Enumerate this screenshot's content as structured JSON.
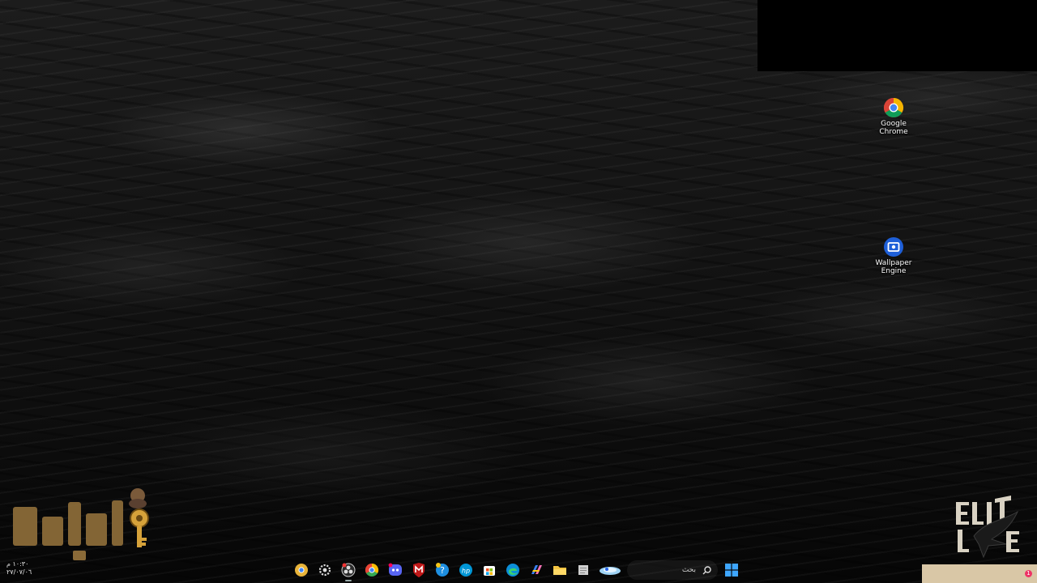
{
  "desktop": {
    "icons": [
      {
        "name": "Google\nChrome",
        "icon": "chrome-icon"
      },
      {
        "name": "Wallpaper\nEngine",
        "icon": "wallpaper-engine-icon"
      }
    ]
  },
  "taskbar": {
    "clock_time": "١٠:٣٠ م",
    "clock_date": "٢٧/٠٧/٠٦",
    "search_placeholder": "بحث",
    "pinned": [
      "chrome-canary-icon",
      "settings-icon",
      "obs-icon",
      "chrome-icon",
      "discord-icon",
      "mcafee-icon",
      "support-assistant-icon",
      "hp-icon",
      "microsoft-store-icon",
      "edge-icon",
      "copilot-icon",
      "file-explorer-icon",
      "notepad-icon",
      "weather-icon"
    ],
    "notification_count": "1"
  },
  "colors": {
    "accent": "#2f8fff",
    "tray_bg": "#d9c7a6",
    "logo_gold": "#8a6a38"
  }
}
